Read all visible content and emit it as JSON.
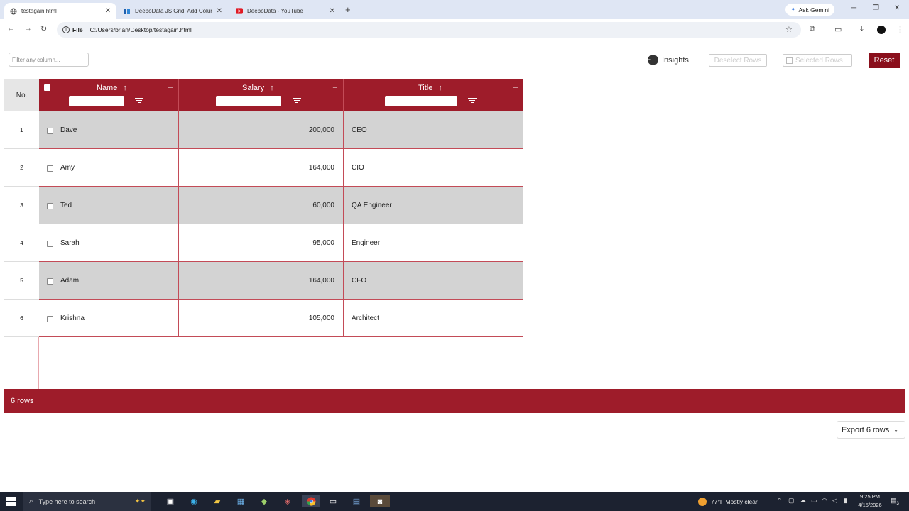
{
  "browser": {
    "tabs": [
      {
        "title": "testagain.html"
      },
      {
        "title": "DeeboData JS Grid: Add Colum"
      },
      {
        "title": "DeeboData - YouTube"
      }
    ],
    "ask_gemini": "Ask Gemini",
    "address_scheme": "File",
    "address_path": "C:/Users/brian/Desktop/testagain.html"
  },
  "toolbar": {
    "filter_placeholder": "Filter any column...",
    "insights_label": "Insights",
    "deselect_label": "Deselect Rows",
    "selected_label": "Selected Rows",
    "reset_label": "Reset"
  },
  "grid": {
    "no_header": "No.",
    "columns": [
      {
        "label": "Name"
      },
      {
        "label": "Salary"
      },
      {
        "label": "Title"
      }
    ],
    "rows": [
      {
        "no": "1",
        "name": "Dave",
        "salary": "200,000",
        "title": "CEO"
      },
      {
        "no": "2",
        "name": "Amy",
        "salary": "164,000",
        "title": "CIO"
      },
      {
        "no": "3",
        "name": "Ted",
        "salary": "60,000",
        "title": "QA Engineer"
      },
      {
        "no": "4",
        "name": "Sarah",
        "salary": "95,000",
        "title": "Engineer"
      },
      {
        "no": "5",
        "name": "Adam",
        "salary": "164,000",
        "title": "CFO"
      },
      {
        "no": "6",
        "name": "Krishna",
        "salary": "105,000",
        "title": "Architect"
      }
    ],
    "footer": "6 rows",
    "export_label": "Export 6 rows"
  },
  "taskbar": {
    "search_placeholder": "Type here to search",
    "weather": "77°F  Mostly clear",
    "time": "9:25 PM",
    "date": "4/15/2026",
    "notification_count": "3"
  },
  "colors": {
    "header_red": "#9e1c2a",
    "reset_red": "#8a0f1c",
    "row_shade": "#d3d3d3"
  }
}
